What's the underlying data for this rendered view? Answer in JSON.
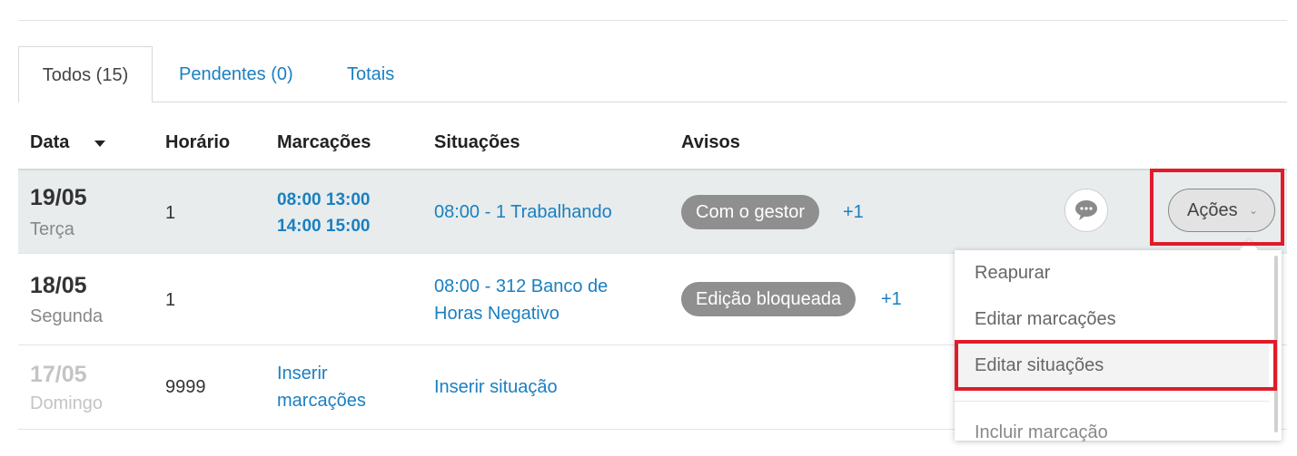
{
  "tabs": [
    {
      "label": "Todos (15)"
    },
    {
      "label": "Pendentes (0)"
    },
    {
      "label": "Totais"
    }
  ],
  "table": {
    "headers": [
      "Data",
      "Horário",
      "Marcações",
      "Situações",
      "Avisos"
    ],
    "sort_icon": "caret-down-icon",
    "rows": [
      {
        "date": "19/05",
        "weekday": "Terça",
        "horario": "1",
        "marcacoes": [
          "08:00 13:00",
          "14:00 15:00"
        ],
        "situacoes": [
          "08:00 - 1 Trabalhando"
        ],
        "aviso": "Com o gestor",
        "aviso_extra": "+1"
      },
      {
        "date": "18/05",
        "weekday": "Segunda",
        "horario": "1",
        "situacoes": [
          "08:00 - 312 Banco de",
          "Horas Negativo"
        ],
        "aviso": "Edição bloqueada",
        "aviso_extra": "+1"
      },
      {
        "date": "17/05",
        "weekday": "Domingo",
        "horario": "9999",
        "marcacoes_link": [
          "Inserir",
          "marcações"
        ],
        "situacoes_link": "Inserir situação"
      }
    ]
  },
  "row_actions": {
    "comment_icon": "speech-bubble-icon",
    "acoes_label": "Ações",
    "acoes_icon": "chevron-down-icon"
  },
  "menu": {
    "items": [
      "Reapurar",
      "Editar marcações",
      "Editar situações",
      "Incluir marcação"
    ]
  },
  "colors": {
    "link": "#1a7fc1",
    "badge": "#8f8f8f",
    "highlight": "#e01b2a",
    "row_selected_bg": "#e8ecec"
  }
}
